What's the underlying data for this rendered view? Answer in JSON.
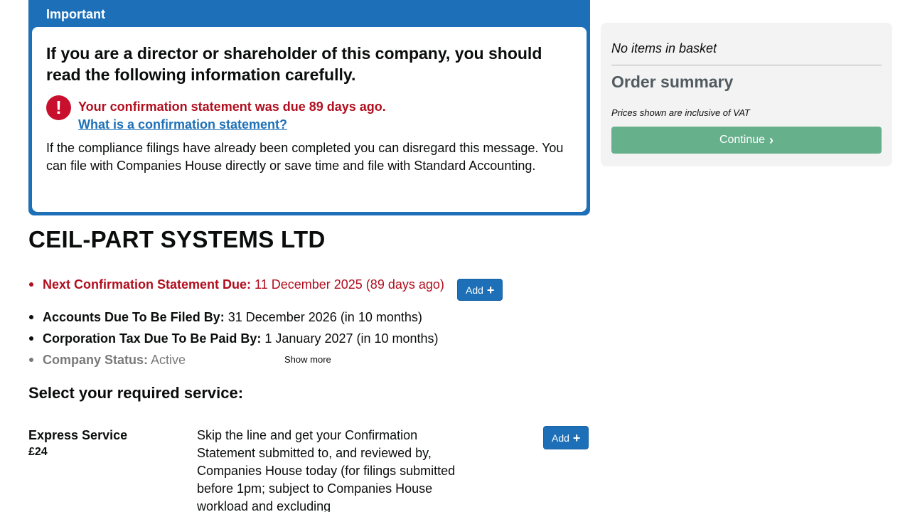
{
  "important": {
    "header": "Important",
    "heading": "If you are a director or shareholder of this company, you should read the following information carefully.",
    "warning_icon_glyph": "!",
    "warning_text": "Your confirmation statement was due 89 days ago.",
    "warning_link": "What is a confirmation statement?",
    "note": "If the compliance filings have already been completed you can disregard this message. You can file with Companies House directly or save time and file with Standard Accounting."
  },
  "company": {
    "name": "CEIL-PART SYSTEMS LTD"
  },
  "details": {
    "confirmation": {
      "label": "Next Confirmation Statement Due:",
      "value": "11 December 2025 (89 days ago)",
      "add_label": "Add"
    },
    "accounts": {
      "label": "Accounts Due To Be Filed By:",
      "value": "31 December 2026 (in 10 months)"
    },
    "corporation_tax": {
      "label": "Corporation Tax Due To Be Paid By:",
      "value": "1 January 2027 (in 10 months)"
    },
    "status": {
      "label": "Company Status:",
      "value": "Active"
    },
    "show_more": "Show more"
  },
  "services": {
    "title": "Select your required service:",
    "items": [
      {
        "name": "Express Service",
        "price": "£24",
        "description": "Skip the line and get your Confirmation Statement submitted to, and reviewed by, Companies House today (for filings submitted before 1pm; subject to Companies House workload and excluding",
        "add_label": "Add"
      }
    ]
  },
  "basket": {
    "empty_text": "No items in basket",
    "title": "Order summary",
    "vat_note": "Prices shown are inclusive of VAT",
    "continue_label": "Continue"
  },
  "colors": {
    "brand_blue": "#1d70b8",
    "warning_red": "#b10e1e",
    "continue_green": "#66b08c",
    "panel_grey": "#f3f3f3"
  }
}
